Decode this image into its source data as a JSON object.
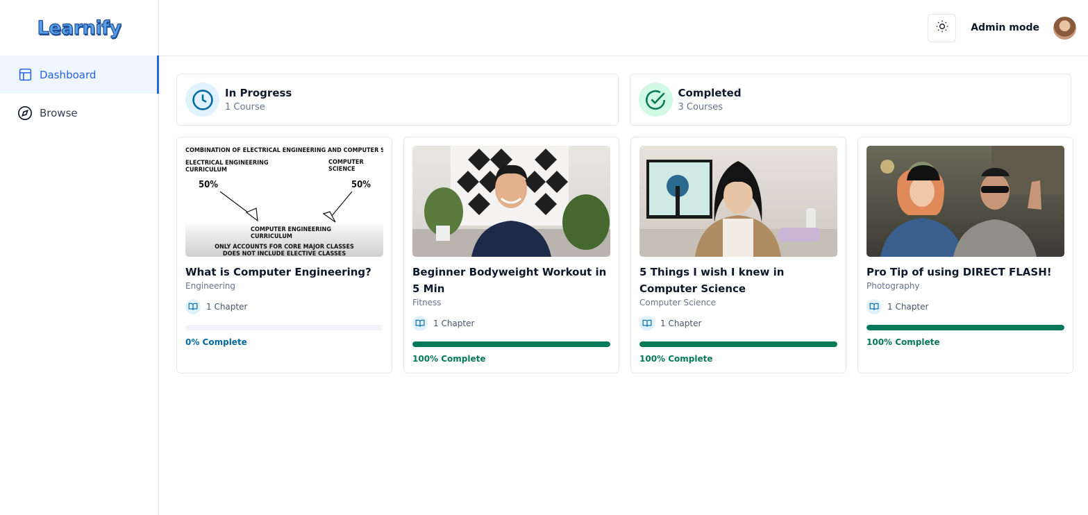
{
  "brand": {
    "name": "Learnify"
  },
  "sidebar": {
    "items": [
      {
        "label": "Dashboard",
        "icon": "layout-icon",
        "active": true
      },
      {
        "label": "Browse",
        "icon": "compass-icon",
        "active": false
      }
    ]
  },
  "topbar": {
    "admin_label": "Admin mode",
    "theme_icon": "sun-icon"
  },
  "stats": [
    {
      "title": "In Progress",
      "subtitle": "1 Course",
      "icon": "clock-icon",
      "color": "#0369a1"
    },
    {
      "title": "Completed",
      "subtitle": "3 Courses",
      "icon": "check-circle-icon",
      "color": "#047857"
    }
  ],
  "courses": [
    {
      "title": "What is Computer Engineering?",
      "category": "Engineering",
      "chapters": "1 Chapter",
      "progress": 0,
      "progress_label": "0% Complete",
      "thumb_text": {
        "header": "COMBINATION OF ELECTRICAL ENGINEERING AND COMPUTER SCIENCE",
        "left": "ELECTRICAL ENGINEERING CURRICULUM",
        "right": "COMPUTER SCIENCE CURRICULUM",
        "pct_left": "50%",
        "pct_right": "50%",
        "center": "COMPUTER ENGINEERING CURRICULUM",
        "footer1": "ONLY ACCOUNTS FOR CORE MAJOR CLASSES",
        "footer2": "DOES NOT INCLUDE ELECTIVE CLASSES"
      }
    },
    {
      "title": "Beginner Bodyweight Workout in 5 Min",
      "category": "Fitness",
      "chapters": "1 Chapter",
      "progress": 100,
      "progress_label": "100% Complete"
    },
    {
      "title": "5 Things I wish I knew in Computer Science",
      "category": "Computer Science",
      "chapters": "1 Chapter",
      "progress": 100,
      "progress_label": "100% Complete"
    },
    {
      "title": "Pro Tip of using DIRECT FLASH!",
      "category": "Photography",
      "chapters": "1 Chapter",
      "progress": 100,
      "progress_label": "100% Complete"
    }
  ]
}
